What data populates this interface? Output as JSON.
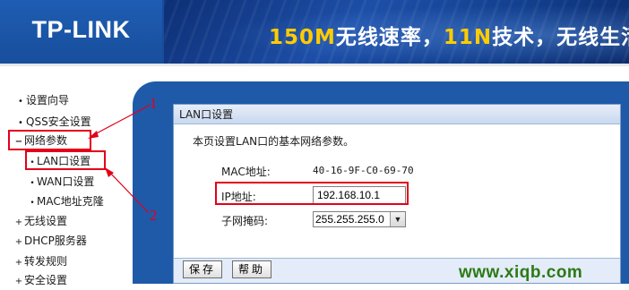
{
  "header": {
    "logo": "TP-LINK",
    "slogan_parts": [
      "150M",
      "无线速率，",
      "11N",
      "技术，无线生活"
    ]
  },
  "sidebar": {
    "items": [
      {
        "label": "设置向导",
        "bullet": "•"
      },
      {
        "label": "QSS安全设置",
        "bullet": "•"
      },
      {
        "label": "网络参数",
        "bullet": "−"
      },
      {
        "label": "LAN口设置",
        "bullet": "•"
      },
      {
        "label": "WAN口设置",
        "bullet": "•"
      },
      {
        "label": "MAC地址克隆",
        "bullet": "•"
      },
      {
        "label": "无线设置",
        "bullet": "+"
      },
      {
        "label": "DHCP服务器",
        "bullet": "+"
      },
      {
        "label": "转发规则",
        "bullet": "+"
      },
      {
        "label": "安全设置",
        "bullet": "+"
      }
    ]
  },
  "panel": {
    "title": "LAN口设置",
    "description": "本页设置LAN口的基本网络参数。",
    "mac": {
      "label": "MAC地址:",
      "value": "40-16-9F-C0-69-70"
    },
    "ip": {
      "label": "IP地址:",
      "value": "192.168.10.1"
    },
    "mask": {
      "label": "子网掩码:",
      "value": "255.255.255.0"
    },
    "buttons": {
      "save": "保存",
      "help": "帮助"
    }
  },
  "annotations": {
    "one": "1",
    "two": "2"
  },
  "watermark": "www.xiqb.com",
  "colors": {
    "header_blue": "#1a4b9a",
    "content_blue": "#1e5aa8",
    "annotation_red": "#e3001b",
    "watermark_green": "#2c7a15"
  }
}
